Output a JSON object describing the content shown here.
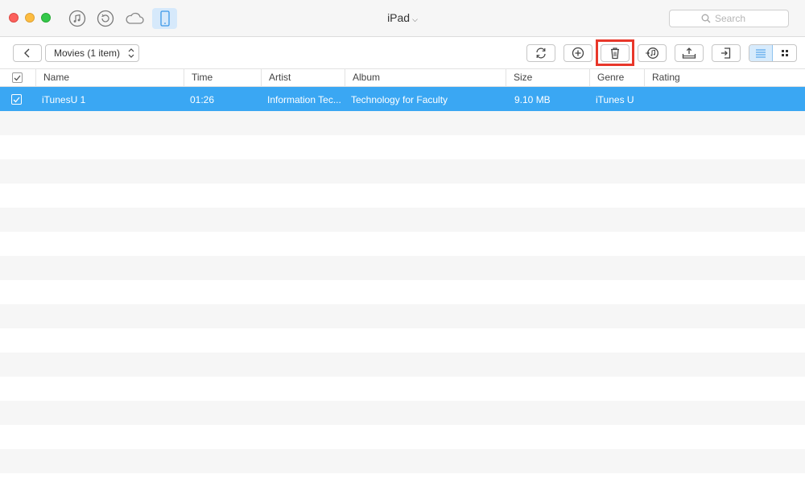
{
  "window": {
    "title": "iPad",
    "search_placeholder": "Search"
  },
  "nav": {
    "icons": [
      "music-note-icon",
      "restore-icon",
      "cloud-icon",
      "device-icon"
    ],
    "active": "device-icon"
  },
  "toolbar": {
    "category_label": "Movies (1 item)",
    "buttons": [
      "refresh-icon",
      "add-icon",
      "delete-icon",
      "to-itunes-icon",
      "to-computer-icon",
      "to-device-icon"
    ],
    "view_modes": [
      "list-view-icon",
      "grid-view-icon"
    ],
    "active_view": "list-view-icon",
    "highlighted_button": "delete-icon",
    "highlight_color": "#e8372a"
  },
  "table": {
    "columns": [
      "Name",
      "Time",
      "Artist",
      "Album",
      "Size",
      "Genre",
      "Rating"
    ],
    "rows": [
      {
        "selected": true,
        "checked": true,
        "name": "iTunesU 1",
        "time": "01:26",
        "artist": "Information Tec...",
        "album": "Technology for Faculty",
        "size": "9.10 MB",
        "genre": "iTunes U",
        "rating": ""
      }
    ]
  },
  "colors": {
    "selection": "#3aa7f3",
    "active_toggle": "#d7ebfc",
    "stripe": "#f6f6f6"
  }
}
